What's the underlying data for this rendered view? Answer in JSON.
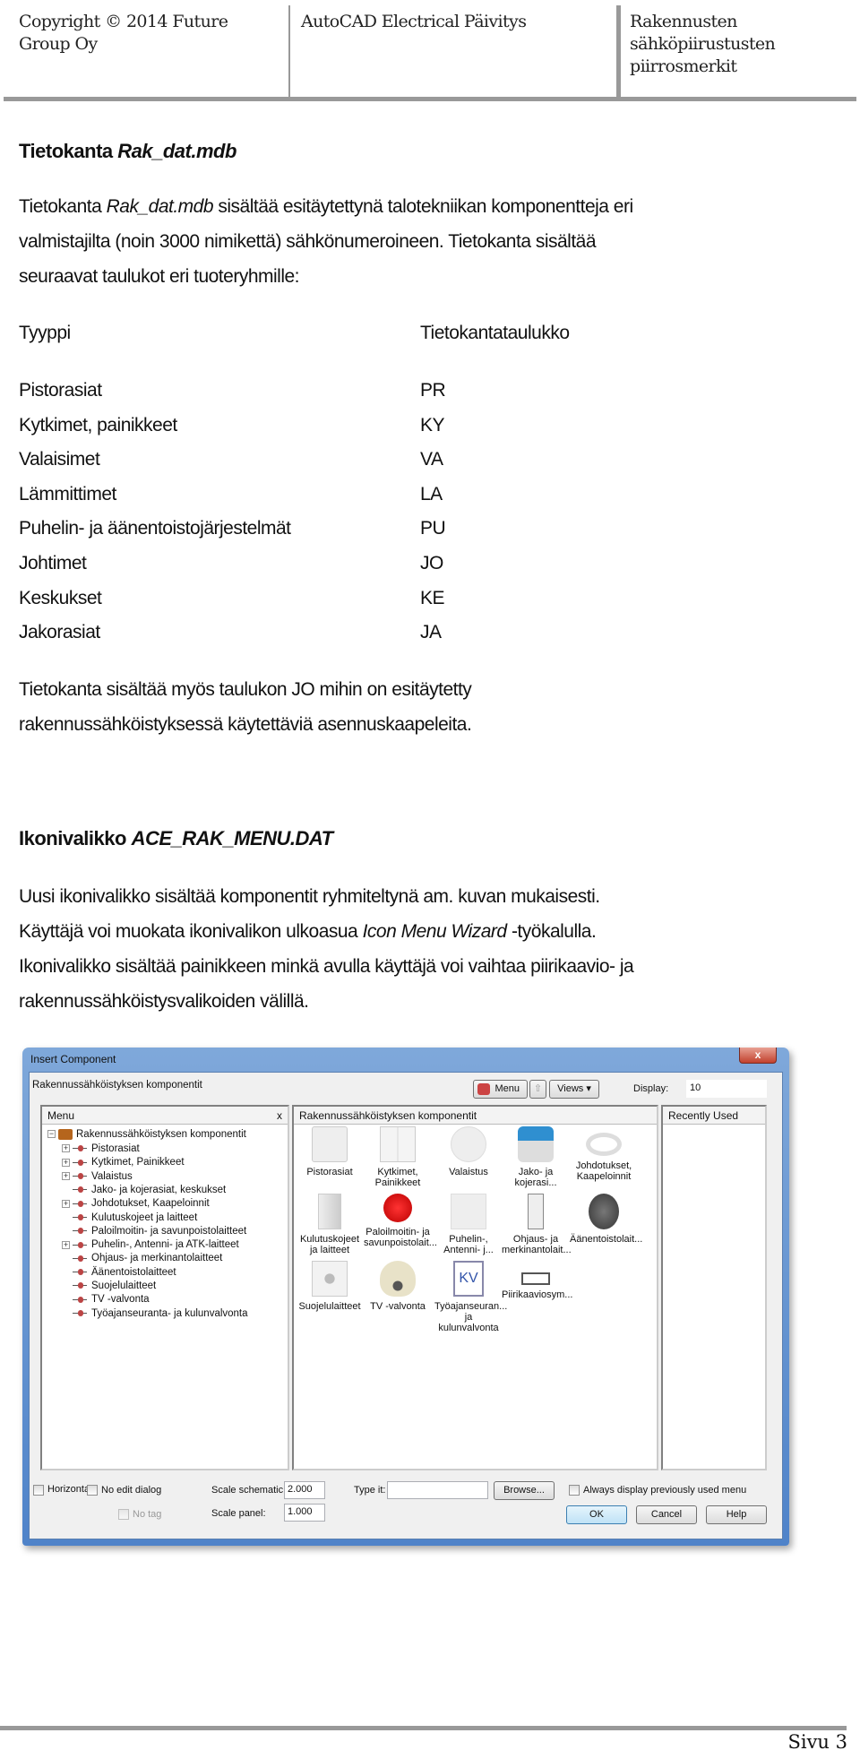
{
  "header": {
    "left": "Copyright © 2014 Future Group Oy",
    "middle": "AutoCAD Electrical Päivitys",
    "right": "Rakennusten sähköpiirustusten piirrosmerkit"
  },
  "section1": {
    "heading_plain": "Tietokanta ",
    "heading_italic": "Rak_dat.mdb",
    "p1_a": "Tietokanta ",
    "p1_italic": "Rak_dat.mdb",
    "p1_b": " sisältää esitäytettynä talotekniikan komponentteja eri",
    "p2": "valmistajilta (noin 3000 nimikettä) sähkönumeroineen. Tietokanta sisältää",
    "p3": "seuraavat taulukot eri tuoteryhmille:",
    "table": {
      "headers": [
        "Tyyppi",
        "Tietokantataulukko"
      ],
      "rows": [
        [
          "Pistorasiat",
          "PR"
        ],
        [
          "Kytkimet, painikkeet",
          "KY"
        ],
        [
          "Valaisimet",
          "VA"
        ],
        [
          "Lämmittimet",
          "LA"
        ],
        [
          "Puhelin- ja äänentoistojärjestelmät",
          "PU"
        ],
        [
          "Johtimet",
          "JO"
        ],
        [
          "Keskukset",
          "KE"
        ],
        [
          "Jakorasiat",
          "JA"
        ]
      ]
    },
    "p4": "Tietokanta sisältää myös  taulukon JO mihin on esitäytetty",
    "p5": "rakennussähköistyksessä käytettäviä asennuskaapeleita."
  },
  "section2": {
    "heading_plain": "Ikonivalikko ",
    "heading_italic": "ACE_RAK_MENU.DAT",
    "l1": "Uusi ikonivalikko sisältää komponentit ryhmiteltynä am. kuvan mukaisesti.",
    "l2_a": "Käyttäjä voi muokata ikonivalikon ulkoasua ",
    "l2_italic": "Icon Menu Wizard",
    "l2_b": " -työkalulla.",
    "l3": "Ikonivalikko sisältää painikkeen minkä avulla käyttäjä voi vaihtaa piirikaavio-  ja",
    "l4": "rakennussähköistysvalikoiden välillä."
  },
  "dialog": {
    "title": "Insert Component",
    "close": "x",
    "subtitle": "Rakennussähköistyksen komponentit",
    "menu_button": "Menu",
    "views_button": "Views ▾",
    "display_label": "Display:",
    "display_value": "10",
    "menu_panel": {
      "title": "Menu",
      "close": "x",
      "root": "Rakennussähköistyksen komponentit",
      "items": [
        {
          "label": "Pistorasiat",
          "exp": true
        },
        {
          "label": "Kytkimet, Painikkeet",
          "exp": true
        },
        {
          "label": "Valaistus",
          "exp": true
        },
        {
          "label": "Jako- ja kojerasiat, keskukset",
          "exp": false
        },
        {
          "label": "Johdotukset, Kaapeloinnit",
          "exp": true
        },
        {
          "label": "Kulutuskojeet ja laitteet",
          "exp": false
        },
        {
          "label": "Paloilmoitin- ja savunpoistolaitteet",
          "exp": false
        },
        {
          "label": "Puhelin-, Antenni- ja ATK-laitteet",
          "exp": true
        },
        {
          "label": "Ohjaus- ja merkinantolaitteet",
          "exp": false
        },
        {
          "label": "Äänentoistolaitteet",
          "exp": false
        },
        {
          "label": "Suojelulaitteet",
          "exp": false
        },
        {
          "label": "TV -valvonta",
          "exp": false
        },
        {
          "label": "Työajanseuranta- ja kulunvalvonta",
          "exp": false
        }
      ]
    },
    "icons_panel": {
      "title": "Rakennussähköistyksen komponentit",
      "icons": [
        {
          "label": "Pistorasiat",
          "icon": "socket-icon"
        },
        {
          "label": "Kytkimet, Painikkeet",
          "icon": "switch-icon"
        },
        {
          "label": "Valaistus",
          "icon": "lamp-icon"
        },
        {
          "label": "Jako- ja kojerasi...",
          "icon": "junction-box-icon"
        },
        {
          "label": "Johdotukset, Kaapeloinnit",
          "icon": "cable-icon"
        },
        {
          "label": "Kulutuskojeet ja laitteet",
          "icon": "heater-icon"
        },
        {
          "label": "Paloilmoitin- ja savunpoistolait...",
          "icon": "fire-alarm-icon"
        },
        {
          "label": "Puhelin-, Antenni- j...",
          "icon": "antenna-socket-icon"
        },
        {
          "label": "Ohjaus- ja merkinantolait...",
          "icon": "pushbutton-icon"
        },
        {
          "label": "Äänentoistolait...",
          "icon": "speaker-icon"
        },
        {
          "label": "Suojelulaitteet",
          "icon": "protection-icon"
        },
        {
          "label": "TV -valvonta",
          "icon": "camera-icon"
        },
        {
          "label": "Työajanseuran... ja kulunvalvonta",
          "icon": "kv-icon",
          "text": "KV"
        },
        {
          "label": "Piirikaaviosym...",
          "icon": "schematic-symbol-icon"
        }
      ]
    },
    "recent_panel": {
      "title": "Recently Used"
    },
    "horizontal": "Horizontal",
    "no_edit": "No edit dialog",
    "no_tag": "No tag",
    "scale_schematic_label": "Scale schematic:",
    "scale_schematic": "2.000",
    "scale_panel_label": "Scale panel:",
    "scale_panel": "1.000",
    "type_it_label": "Type it:",
    "type_it": "",
    "browse": "Browse...",
    "always_display": "Always display previously used menu",
    "ok": "OK",
    "cancel": "Cancel",
    "help": "Help"
  },
  "footer": {
    "page": "Sivu 3"
  }
}
